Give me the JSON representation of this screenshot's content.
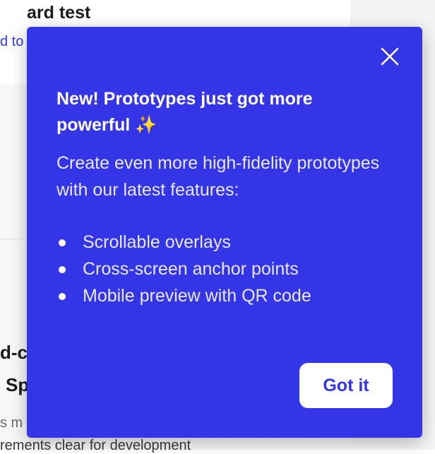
{
  "background": {
    "card_title": "ard test",
    "card_link": "d to",
    "heading_line1": "d-c",
    "heading_line2": "Sp",
    "para_line1": "s m",
    "para_line2": "rements clear for development"
  },
  "popover": {
    "title": "New! Prototypes just got more powerful",
    "title_emoji": "✨",
    "description": "Create even more high-fidelity prototypes with our latest features:",
    "features": [
      "Scrollable overlays",
      "Cross-screen anchor points",
      "Mobile preview with QR code"
    ],
    "button_label": "Got it",
    "close_icon": "close-icon",
    "colors": {
      "background": "#3535e8",
      "button_bg": "#ffffff",
      "button_text": "#3535e8"
    }
  }
}
